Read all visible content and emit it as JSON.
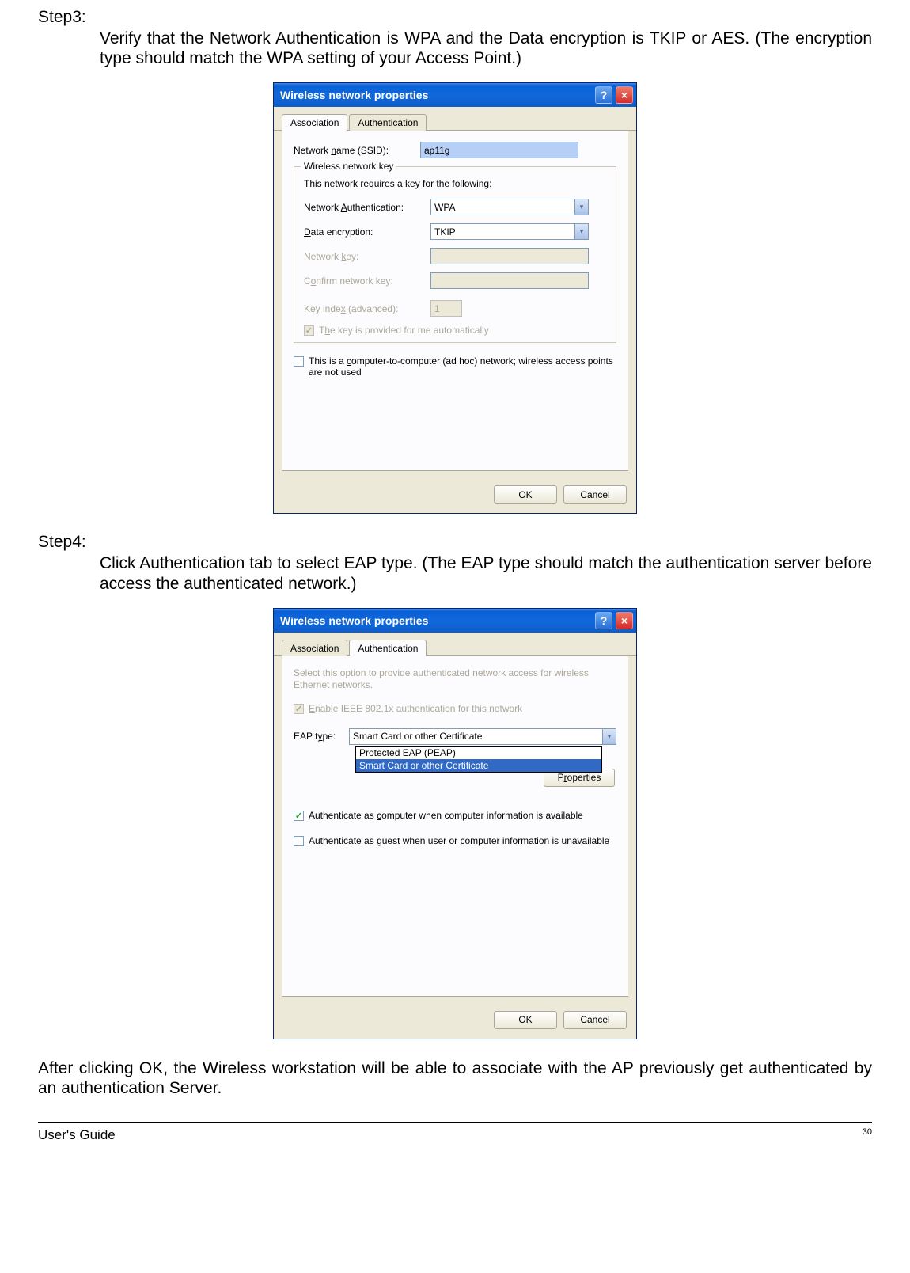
{
  "step3": {
    "label": "Step3:",
    "body": "Verify that the Network Authentication is WPA and the Data encryption is TKIP or AES. (The encryption type should match the WPA setting of your Access Point.)"
  },
  "step4": {
    "label": "Step4:",
    "body": "Click Authentication tab to select EAP type. (The EAP type should match the authentication server before access the authenticated network.)"
  },
  "dialog1": {
    "title": "Wireless network properties",
    "tabs": {
      "association": "Association",
      "authentication": "Authentication"
    },
    "ssid_label": "Network name (SSID):",
    "ssid_value": "ap11g",
    "groupbox": "Wireless network key",
    "group_desc": "This network requires a key for the following:",
    "netauth_label": "Network Authentication:",
    "netauth_value": "WPA",
    "dataenc_label": "Data encryption:",
    "dataenc_value": "TKIP",
    "netkey_label": "Network key:",
    "confirmkey_label": "Confirm network key:",
    "keyindex_label": "Key index (advanced):",
    "keyindex_value": "1",
    "autokey_label": "The key is provided for me automatically",
    "adhoc_label": "This is a computer-to-computer (ad hoc) network; wireless access points are not used",
    "ok": "OK",
    "cancel": "Cancel"
  },
  "dialog2": {
    "title": "Wireless network properties",
    "tabs": {
      "association": "Association",
      "authentication": "Authentication"
    },
    "desc": "Select this option to provide authenticated network access for wireless Ethernet networks.",
    "enable8021x": "Enable IEEE 802.1x authentication for this network",
    "eap_label": "EAP type:",
    "eap_value": "Smart Card or other Certificate",
    "eap_options": [
      "Protected EAP (PEAP)",
      "Smart Card or other Certificate"
    ],
    "properties": "Properties",
    "auth_computer": "Authenticate as computer when computer information is available",
    "auth_guest": "Authenticate as guest when user or computer information is unavailable",
    "ok": "OK",
    "cancel": "Cancel"
  },
  "closing": "After clicking OK, the Wireless workstation will be able to associate with the AP previously get authenticated by an authentication Server.",
  "footer": {
    "guide": "User's Guide",
    "page": "30"
  }
}
